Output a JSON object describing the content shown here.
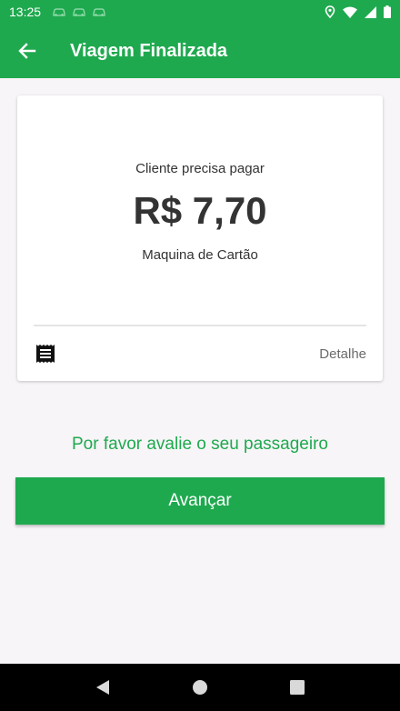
{
  "status_bar": {
    "time": "13:25",
    "icons": [
      "car-notification-icon",
      "car-notification-icon",
      "car-notification-icon",
      "location-icon",
      "wifi-icon",
      "signal-icon",
      "battery-icon"
    ]
  },
  "app_bar": {
    "title": "Viagem Finalizada",
    "back_icon": "arrow-left-icon"
  },
  "payment_card": {
    "subtitle": "Cliente precisa pagar",
    "amount": "R$ 7,70",
    "payment_method": "Maquina de Cartão",
    "receipt_icon": "receipt-icon",
    "detail_label": "Detalhe"
  },
  "rating": {
    "prompt": "Por favor avalie o seu passageiro"
  },
  "actions": {
    "advance_label": "Avançar"
  },
  "nav_bar": {
    "icons": [
      "nav-back-icon",
      "nav-home-icon",
      "nav-recents-icon"
    ]
  },
  "colors": {
    "primary": "#1fa94f",
    "background": "#f7f5f7",
    "text": "#333333",
    "muted": "#6b6b6b"
  }
}
